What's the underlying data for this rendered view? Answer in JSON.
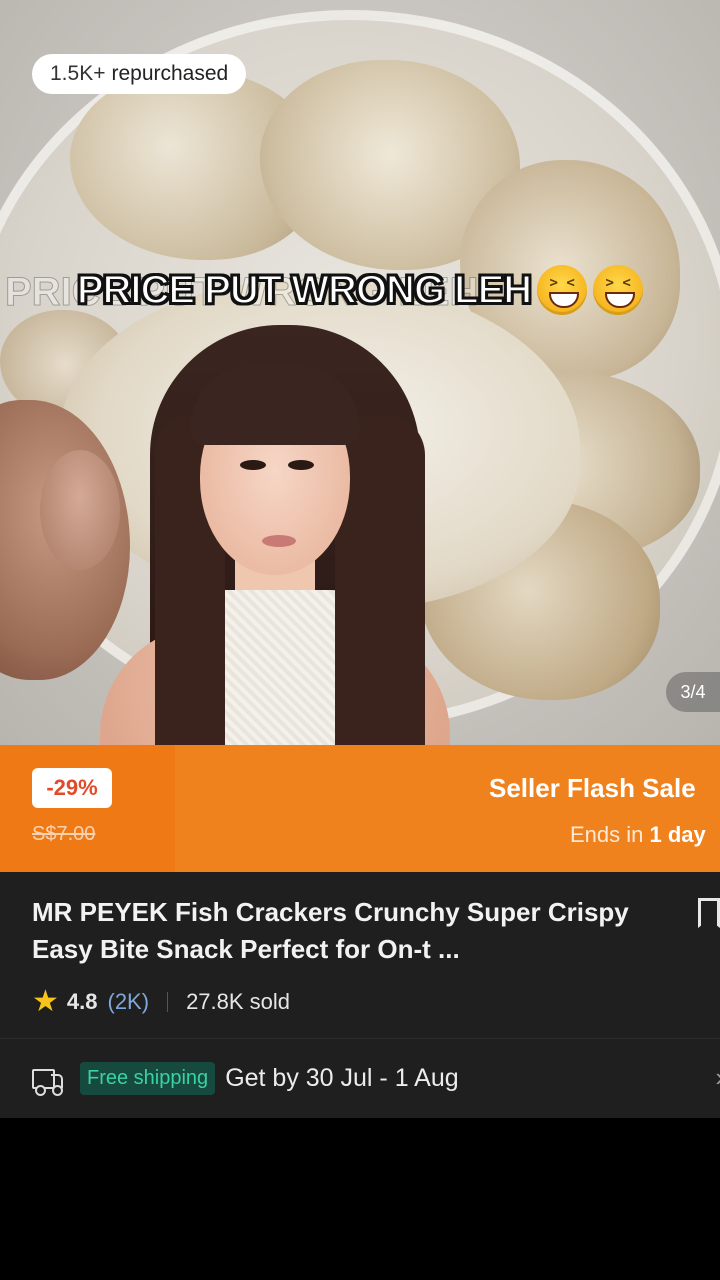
{
  "photo": {
    "badge": {
      "count": "1.5K+",
      "label": "repurchased"
    },
    "caption": "PRICE PUT WRONG LEH",
    "caption_ghost": "PRICE PUT WRONG LEH",
    "emoji": "laughing-squinting-face",
    "pager": "3/4"
  },
  "flash_sale": {
    "discount": "-29%",
    "original_price": "S$7.00",
    "title": "Seller Flash Sale",
    "ends_prefix": "Ends in",
    "ends_value": "1 day"
  },
  "product": {
    "title": "MR PEYEK Fish Crackers Crunchy  Super Crispy Easy Bite Snack Perfect for On-t ...",
    "rating": "4.8",
    "reviews": "(2K)",
    "sold": "27.8K sold"
  },
  "shipping": {
    "badge": "Free shipping",
    "delivery": "Get by 30 Jul - 1 Aug"
  },
  "colors": {
    "flash_orange": "#f0821e",
    "discount_red": "#e24b2a",
    "free_ship_green": "#39d2a4",
    "star_yellow": "#f7c51a"
  }
}
